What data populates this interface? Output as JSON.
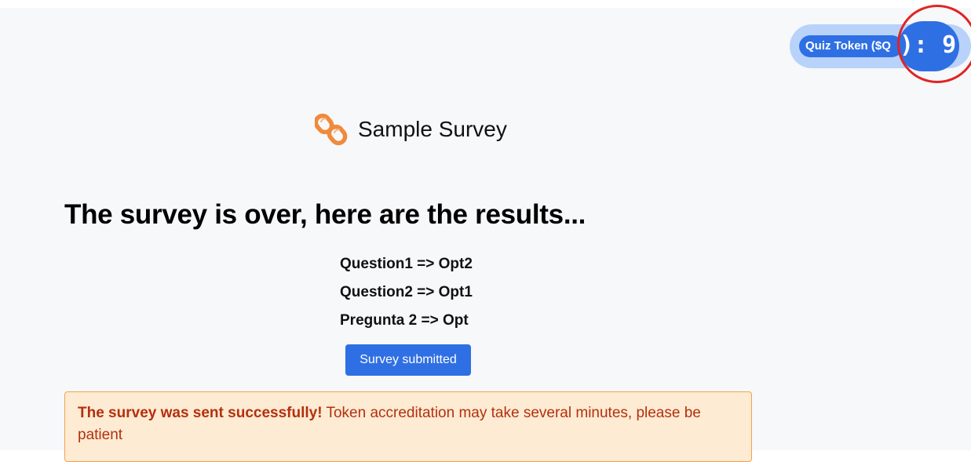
{
  "token": {
    "label": "Quiz Token ($Q",
    "value": "): 9",
    "colors": {
      "pill_bg": "#b8d2fa",
      "badge_bg": "#2f6fe4",
      "highlight_ring": "#e02424"
    }
  },
  "header": {
    "icon": "link-chain-icon",
    "icon_color": "#f08a3c",
    "title": "Sample Survey"
  },
  "results": {
    "heading": "The survey is over, here are the results...",
    "items": [
      "Question1 => Opt2",
      "Question2 => Opt1",
      "Pregunta 2 => Opt"
    ]
  },
  "submit_button": {
    "label": "Survey submitted",
    "color": "#2f6fe4"
  },
  "alert": {
    "strong": "The survey was sent successfully!",
    "message": "Token accreditation may take several minutes, please be patient",
    "text_color": "#b4300e",
    "bg_color": "#fdebd3",
    "border_color": "#f2a24a"
  }
}
